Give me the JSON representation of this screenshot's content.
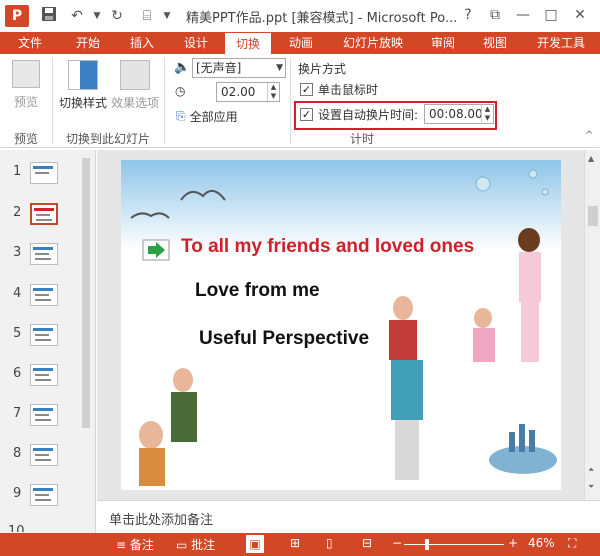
{
  "titlebar": {
    "app_icon": "P",
    "doc_title": "精美PPT作品.ppt [兼容模式] - Microsoft Po...",
    "help": "?",
    "restore": "⧉",
    "minimize": "—",
    "maximize": "□",
    "close": "✕"
  },
  "tabs": [
    "文件",
    "开始",
    "插入",
    "设计",
    "切换",
    "动画",
    "幻灯片放映",
    "审阅",
    "视图",
    "开发工具"
  ],
  "ribbon": {
    "preview_label": "预览",
    "switch_style_label": "切换样式",
    "effect_options_label": "效果选项",
    "sound_value": "[无声音]",
    "duration_value": "02.00",
    "apply_all_label": "全部应用",
    "switch_mode_title": "换片方式",
    "on_click_label": "单击鼠标时",
    "auto_time_label": "设置自动换片时间:",
    "auto_time_value": "00:08.00",
    "group_preview": "预览",
    "group_transition": "切换到此幻灯片",
    "group_timing": "计时"
  },
  "thumbnails": [
    "1",
    "2",
    "3",
    "4",
    "5",
    "6",
    "7",
    "8",
    "9",
    "10"
  ],
  "slide": {
    "line1": "To all my friends and loved ones",
    "line2": "Love from me",
    "line3": "Useful Perspective"
  },
  "notes_placeholder": "单击此处添加备注",
  "statusbar": {
    "notes_label": "备注",
    "comments_label": "批注",
    "zoom_percent": "46%"
  },
  "colors": {
    "accent": "#d24726",
    "slide_title": "#d0202a"
  }
}
